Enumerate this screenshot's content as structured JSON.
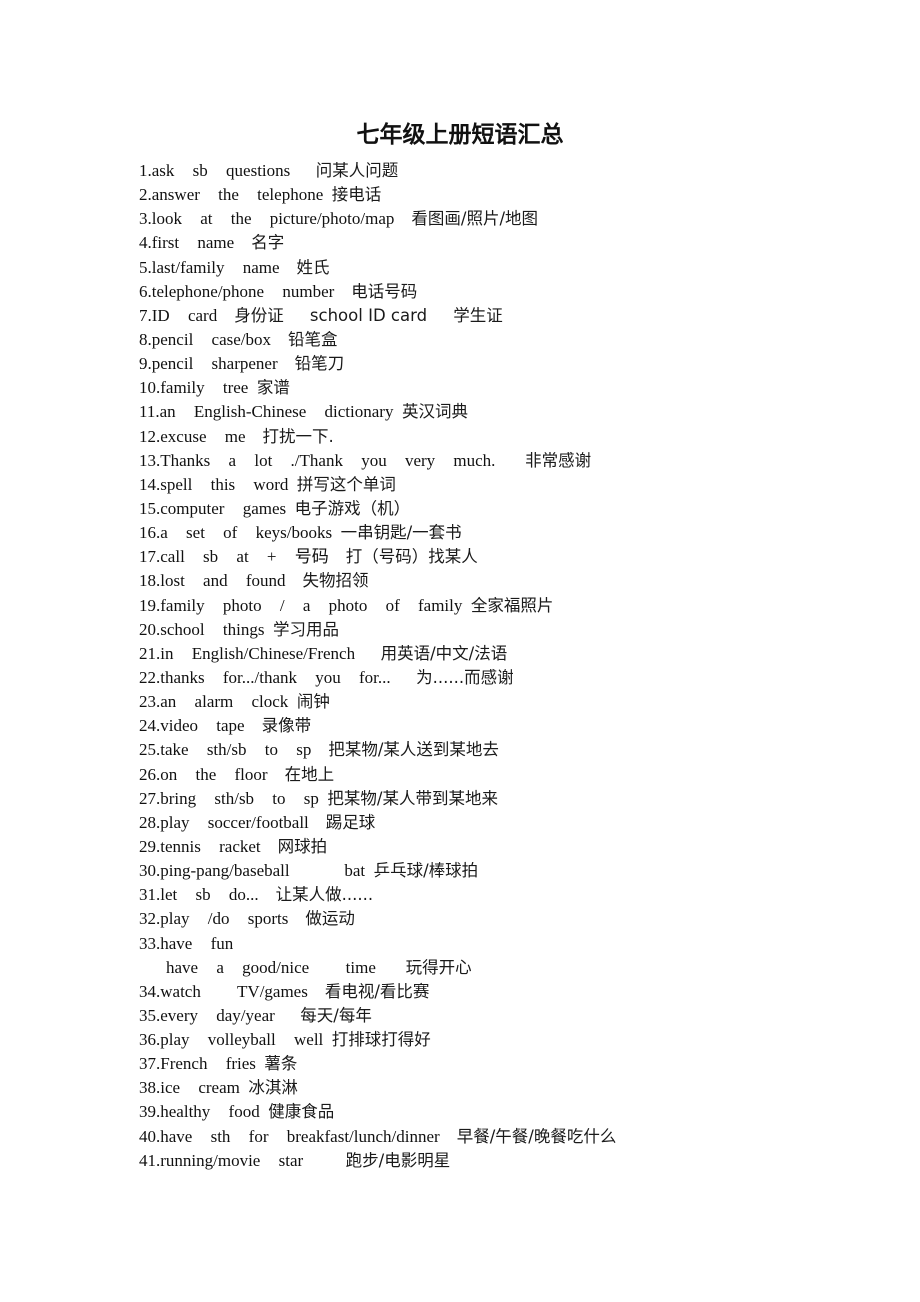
{
  "document": {
    "title": "七年级上册短语汇总",
    "phrases": [
      {
        "en": "1.ask sb questions",
        "gap": "      ",
        "zh": "问某人问题"
      },
      {
        "en": "2.answer the telephone",
        "gap": "  ",
        "zh": "接电话"
      },
      {
        "en": "3.look at the picture/photo/map",
        "gap": "    ",
        "zh": "看图画/照片/地图"
      },
      {
        "en": "4.first name",
        "gap": "    ",
        "zh": "名字"
      },
      {
        "en": "5.last/family name",
        "gap": "    ",
        "zh": "姓氏"
      },
      {
        "en": "6.telephone/phone number",
        "gap": "    ",
        "zh": "电话号码"
      },
      {
        "en": "7.ID card",
        "gap": "    ",
        "zh": "身份证     school ID card     学生证"
      },
      {
        "en": "8.pencil case/box",
        "gap": "    ",
        "zh": "铅笔盒"
      },
      {
        "en": "9.pencil sharpener",
        "gap": "    ",
        "zh": "铅笔刀"
      },
      {
        "en": "10.family tree",
        "gap": "  ",
        "zh": "家谱"
      },
      {
        "en": "11.an English-Chinese dictionary",
        "gap": "  ",
        "zh": "英汉词典"
      },
      {
        "en": "12.excuse me",
        "gap": "    ",
        "zh": "打扰一下."
      },
      {
        "en": "13.Thanks a lot ./Thank you very much.",
        "gap": "       ",
        "zh": "非常感谢"
      },
      {
        "en": "14.spell this word",
        "gap": "  ",
        "zh": "拼写这个单词"
      },
      {
        "en": "15.computer games",
        "gap": "  ",
        "zh": "电子游戏（机）"
      },
      {
        "en": "16.a set of keys/books",
        "gap": "  ",
        "zh": "一串钥匙/一套书"
      },
      {
        "en": "17.call sb at + 号码",
        "gap": "    ",
        "zh": "打（号码）找某人"
      },
      {
        "en": "18.lost and found",
        "gap": "    ",
        "zh": "失物招领"
      },
      {
        "en": "19.family photo / a photo of family",
        "gap": "  ",
        "zh": "全家福照片"
      },
      {
        "en": "20.school things",
        "gap": "  ",
        "zh": "学习用品"
      },
      {
        "en": "21.in English/Chinese/French",
        "gap": "      ",
        "zh": "用英语/中文/法语"
      },
      {
        "en": "22.thanks for.../thank you for...",
        "gap": "      ",
        "zh": "为......而感谢"
      },
      {
        "en": "23.an alarm clock",
        "gap": "  ",
        "zh": "闹钟"
      },
      {
        "en": "24.video tape",
        "gap": "    ",
        "zh": "录像带"
      },
      {
        "en": "25.take sth/sb to sp",
        "gap": "    ",
        "zh": "把某物/某人送到某地去"
      },
      {
        "en": "26.on the floor",
        "gap": "    ",
        "zh": "在地上"
      },
      {
        "en": "27.bring sth/sb to sp",
        "gap": "  ",
        "zh": "把某物/某人带到某地来"
      },
      {
        "en": "28.play soccer/football",
        "gap": "    ",
        "zh": "踢足球"
      },
      {
        "en": "29.tennis racket",
        "gap": "    ",
        "zh": "网球拍"
      },
      {
        "en": "30.ping-pang/baseball   bat",
        "gap": "  ",
        "zh": "乒乓球/棒球拍"
      },
      {
        "en": "31.let sb do...",
        "gap": "    ",
        "zh": "让某人做......"
      },
      {
        "en": "32.play /do sports",
        "gap": "    ",
        "zh": "做运动"
      },
      {
        "en": "33.have fun",
        "gap": "",
        "zh": ""
      },
      {
        "en": "have a good/nice  time",
        "gap": "       ",
        "zh": "玩得开心",
        "indent": true
      },
      {
        "en": "34.watch  TV/games",
        "gap": "    ",
        "zh": "看电视/看比赛"
      },
      {
        "en": "35.every day/year",
        "gap": "      ",
        "zh": "每天/每年"
      },
      {
        "en": "36.play volleyball well",
        "gap": "  ",
        "zh": "打排球打得好"
      },
      {
        "en": "37.French fries",
        "gap": "  ",
        "zh": "薯条"
      },
      {
        "en": "38.ice cream",
        "gap": "  ",
        "zh": "冰淇淋"
      },
      {
        "en": "39.healthy food",
        "gap": "  ",
        "zh": "健康食品"
      },
      {
        "en": "40.have sth for breakfast/lunch/dinner",
        "gap": "    ",
        "zh": "早餐/午餐/晚餐吃什么"
      },
      {
        "en": "41.running/movie star",
        "gap": "          ",
        "zh": "跑步/电影明星"
      }
    ]
  }
}
